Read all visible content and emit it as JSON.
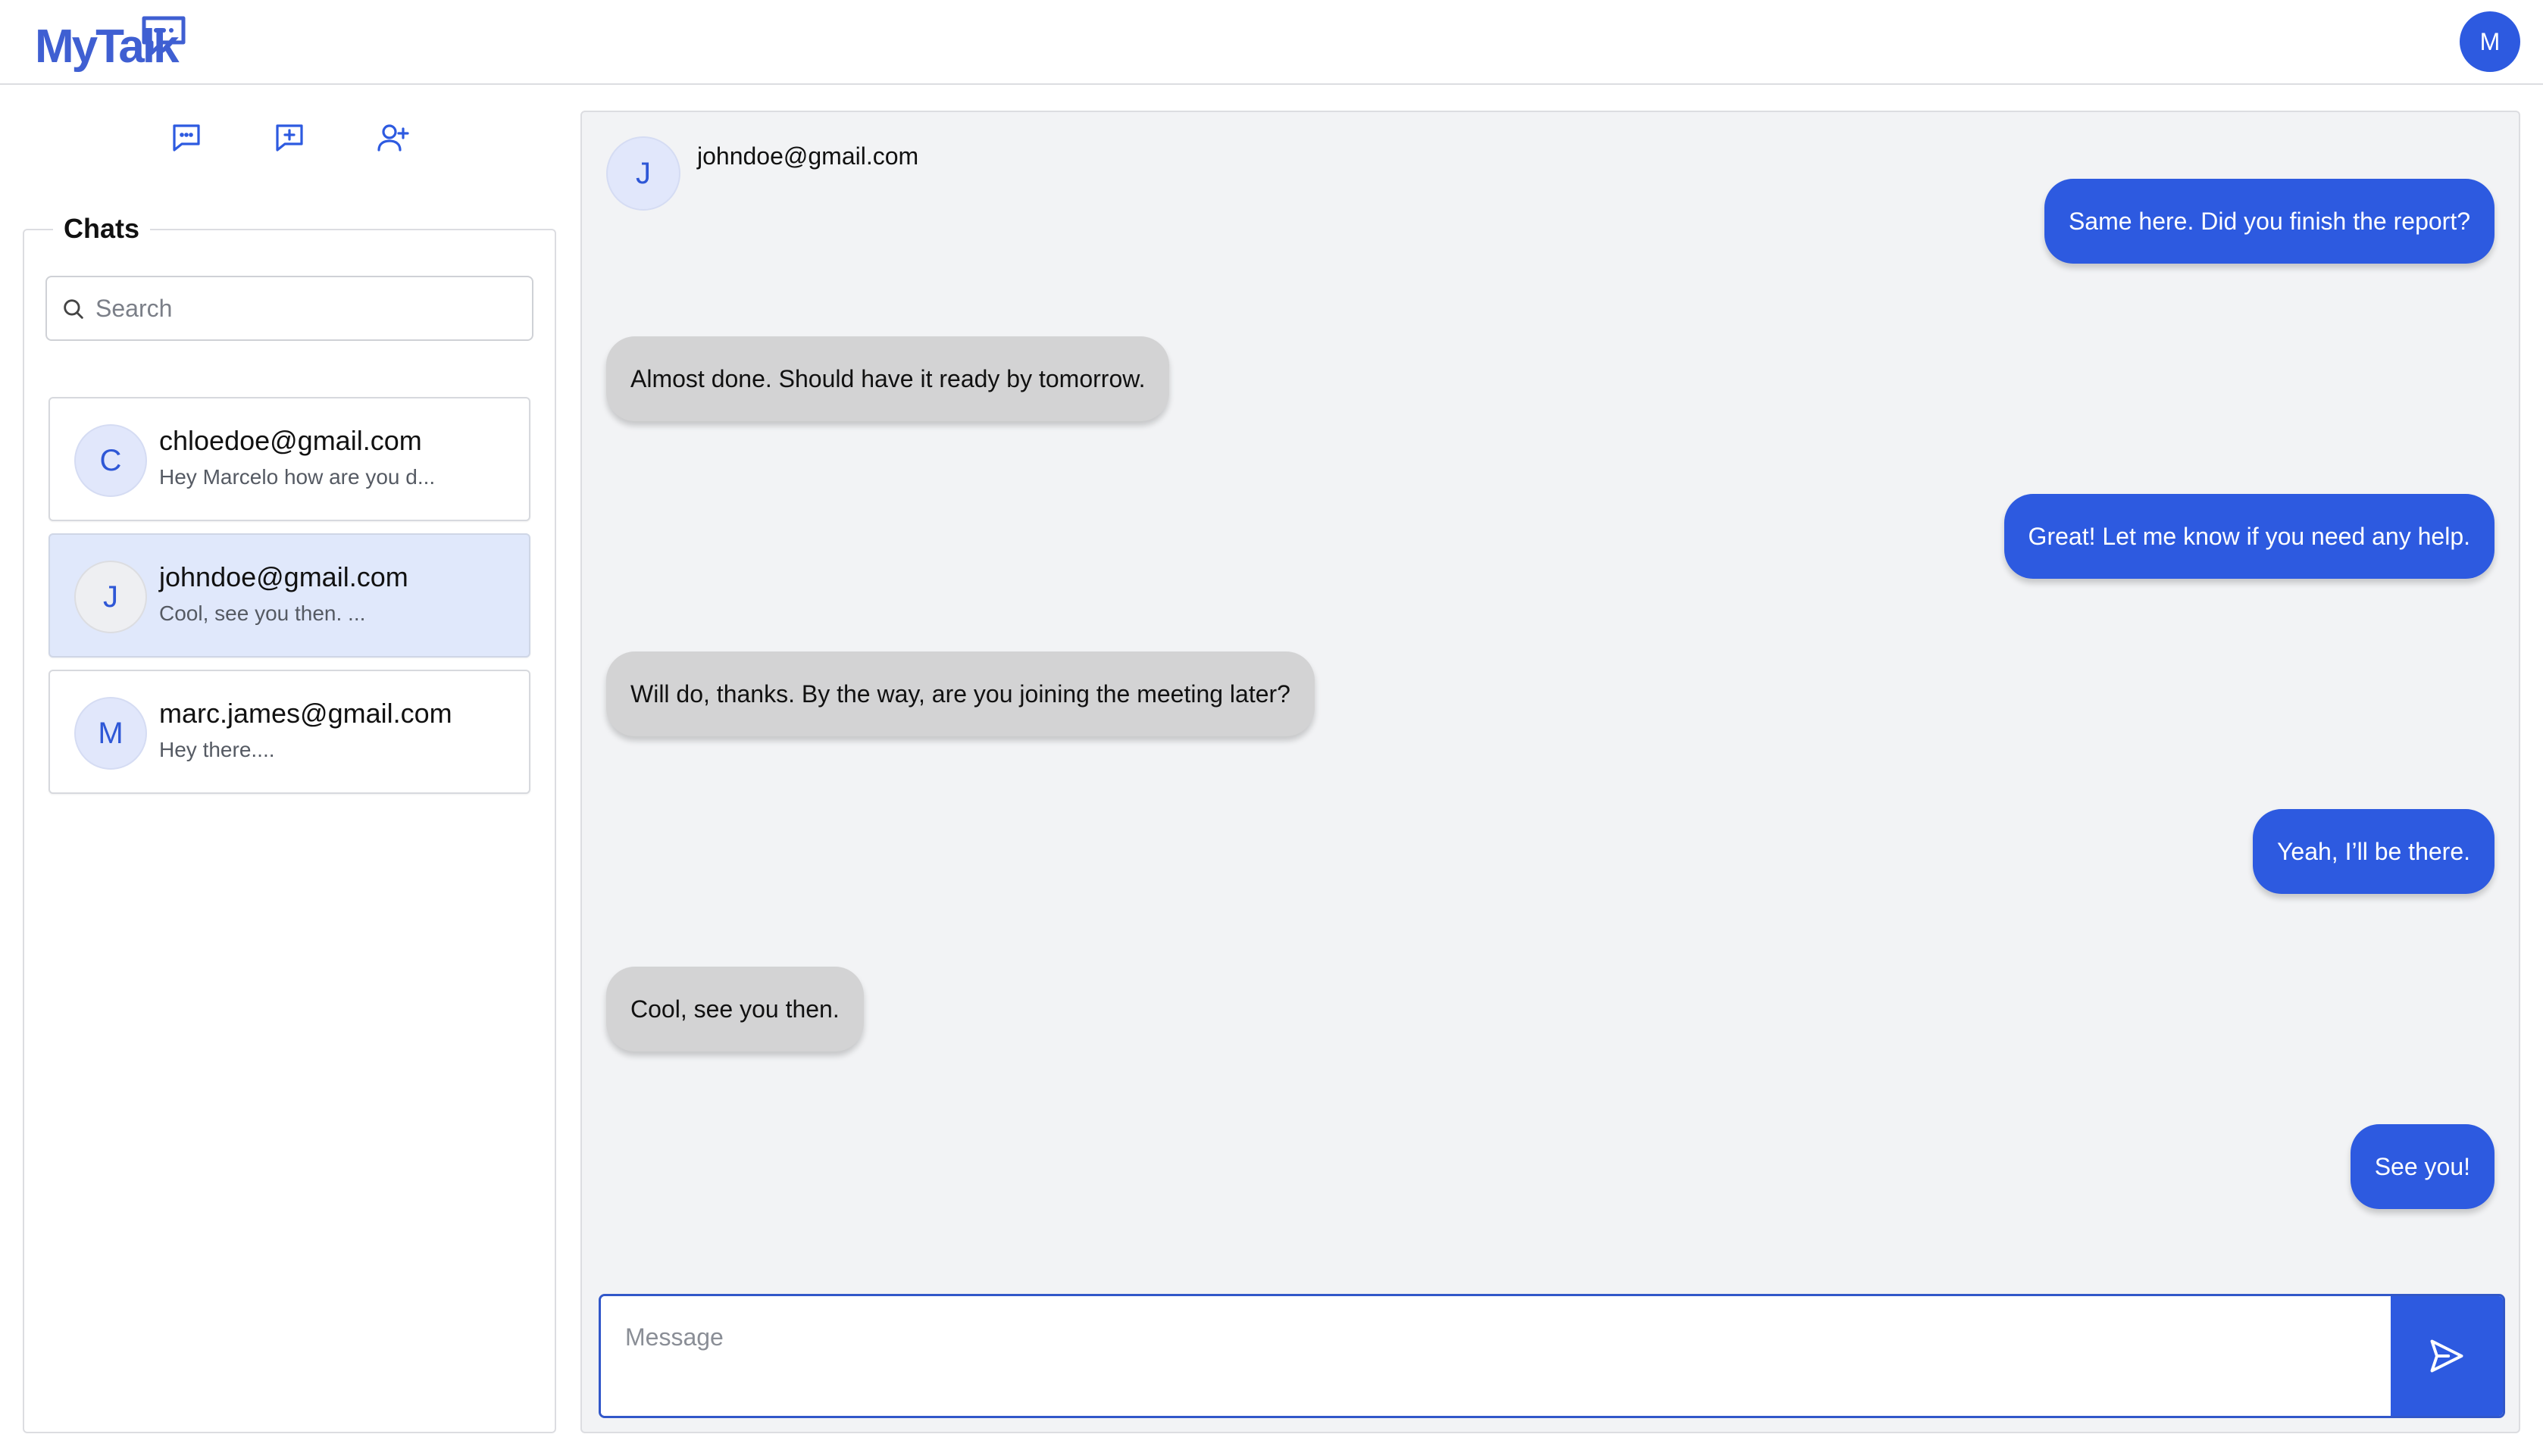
{
  "app": {
    "logo_text": "MyTalk",
    "user_initial": "M",
    "accent_color": "#2d5ae0"
  },
  "sidebar": {
    "actions": [
      {
        "icon": "chat-bubble-icon"
      },
      {
        "icon": "new-chat-icon"
      },
      {
        "icon": "add-user-icon"
      }
    ],
    "chats_title": "Chats",
    "search": {
      "placeholder": "Search",
      "value": ""
    },
    "chats": [
      {
        "initial": "C",
        "email": "chloedoe@gmail.com",
        "preview": "Hey Marcelo how are you d...",
        "active": false
      },
      {
        "initial": "J",
        "email": "johndoe@gmail.com",
        "preview": "Cool, see you then. ...",
        "active": true
      },
      {
        "initial": "M",
        "email": "marc.james@gmail.com",
        "preview": "Hey there....",
        "active": false
      }
    ]
  },
  "conversation": {
    "contact_initial": "J",
    "contact_email": "johndoe@gmail.com",
    "messages": [
      {
        "from": "me",
        "text": "Same here. Did you finish the report?"
      },
      {
        "from": "them",
        "text": "Almost done. Should have it ready by tomorrow."
      },
      {
        "from": "me",
        "text": "Great! Let me know if you need any help."
      },
      {
        "from": "them",
        "text": "Will do, thanks. By the way, are you joining the meeting later?"
      },
      {
        "from": "me",
        "text": "Yeah, I’ll be there."
      },
      {
        "from": "them",
        "text": "Cool, see you then."
      },
      {
        "from": "me",
        "text": "See you!"
      }
    ],
    "composer": {
      "placeholder": "Message",
      "value": ""
    }
  }
}
